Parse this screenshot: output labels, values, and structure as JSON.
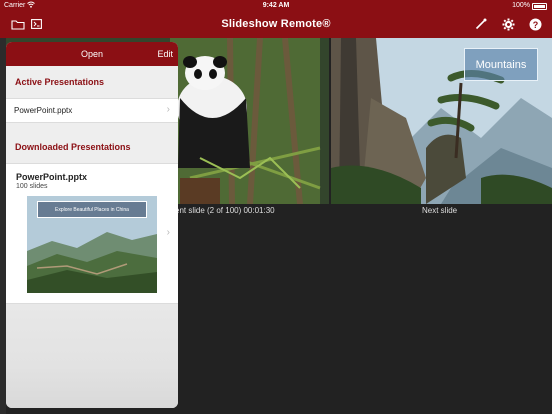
{
  "status_bar": {
    "carrier": "Carrier",
    "time": "9:42 AM",
    "battery": "100%"
  },
  "nav": {
    "title": "Slideshow Remote®",
    "icons": [
      "folder-icon",
      "slides-icon",
      "laser-pointer-icon",
      "gear-icon",
      "help-icon"
    ]
  },
  "slides": {
    "current_caption": "ent slide (2 of 100) 00:01:30",
    "next_caption": "Next slide",
    "next_title": "Mountains"
  },
  "open_panel": {
    "title": "Open",
    "edit_label": "Edit",
    "active_header": "Active Presentations",
    "active_items": [
      {
        "name": "PowerPoint.pptx"
      }
    ],
    "downloaded_header": "Downloaded Presentations",
    "downloaded_items": [
      {
        "name": "PowerPoint.pptx",
        "detail": "100 slides",
        "thumbnail_caption": "Explore Beautiful Places in China"
      }
    ]
  },
  "colors": {
    "brand": "#8b0f14",
    "panel_bg": "#eeeeee"
  }
}
